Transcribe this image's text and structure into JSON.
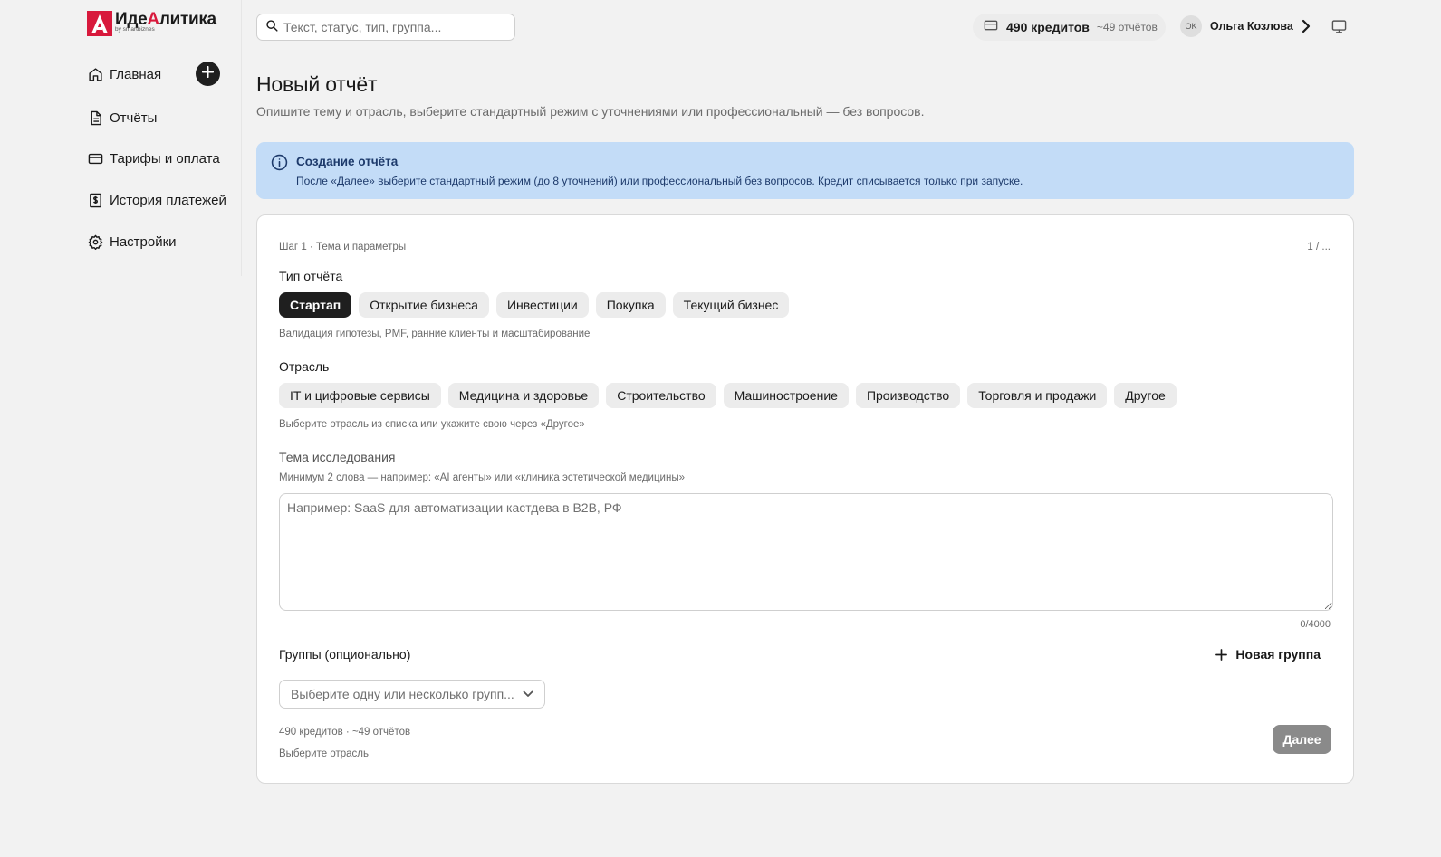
{
  "brand": {
    "name_part1": "Иде",
    "name_accent": "А",
    "name_part2": "литика",
    "tagline": "by smartbiznes",
    "color": "#d8193c"
  },
  "sidebar": {
    "items": [
      {
        "label": "Главная",
        "icon": "home-icon"
      },
      {
        "label": "Отчёты",
        "icon": "document-icon"
      },
      {
        "label": "Тарифы и оплата",
        "icon": "credit-card-icon"
      },
      {
        "label": "История платежей",
        "icon": "receipt-dollar-icon"
      },
      {
        "label": "Настройки",
        "icon": "gear-icon"
      }
    ],
    "add_icon": "plus-icon"
  },
  "header": {
    "search_placeholder": "Текст, статус, тип, группа...",
    "credits": "490 кредитов",
    "credits_approx": "~49 отчётов",
    "user_initials": "OK",
    "user_name": "Ольга Козлова"
  },
  "page": {
    "title": "Новый отчёт",
    "subtitle": "Опишите тему и отрасль, выберите стандартный режим с уточнениями или профессиональный — без вопросов."
  },
  "info": {
    "title": "Создание отчёта",
    "text": "После «Далее» выберите стандартный режим (до 8 уточнений) или профессиональный без вопросов. Кредит списывается только при запуске.",
    "color": "#c3dcf7"
  },
  "form": {
    "step": "Шаг 1 · Тема и параметры",
    "step_count": "1 / ...",
    "report_type_label": "Тип отчёта",
    "report_types": [
      "Стартап",
      "Открытие бизнеса",
      "Инвестиции",
      "Покупка",
      "Текущий бизнес"
    ],
    "report_type_selected": "Стартап",
    "report_type_hint": "Валидация гипотезы, PMF, ранние клиенты и масштабирование",
    "industry_label": "Отрасль",
    "industries": [
      "IT и цифровые сервисы",
      "Медицина и здоровье",
      "Строительство",
      "Машиностроение",
      "Производство",
      "Торговля и продажи",
      "Другое"
    ],
    "industry_hint": "Выберите отрасль из списка или укажите свою через «Другое»",
    "topic_label": "Тема исследования",
    "topic_hint": "Минимум 2 слова — например: «AI агенты» или «клиника эстетической медицины»",
    "topic_placeholder": "Например: SaaS для автоматизации кастдева в B2B, РФ",
    "topic_value": "",
    "char_count": "0/4000",
    "groups_label": "Группы (опционально)",
    "new_group": "Новая группа",
    "groups_placeholder": "Выберите одну или несколько групп...",
    "footer_credits": "490 кредитов · ~49 отчётов",
    "footer_hint": "Выберите отрасль",
    "next": "Далее"
  }
}
